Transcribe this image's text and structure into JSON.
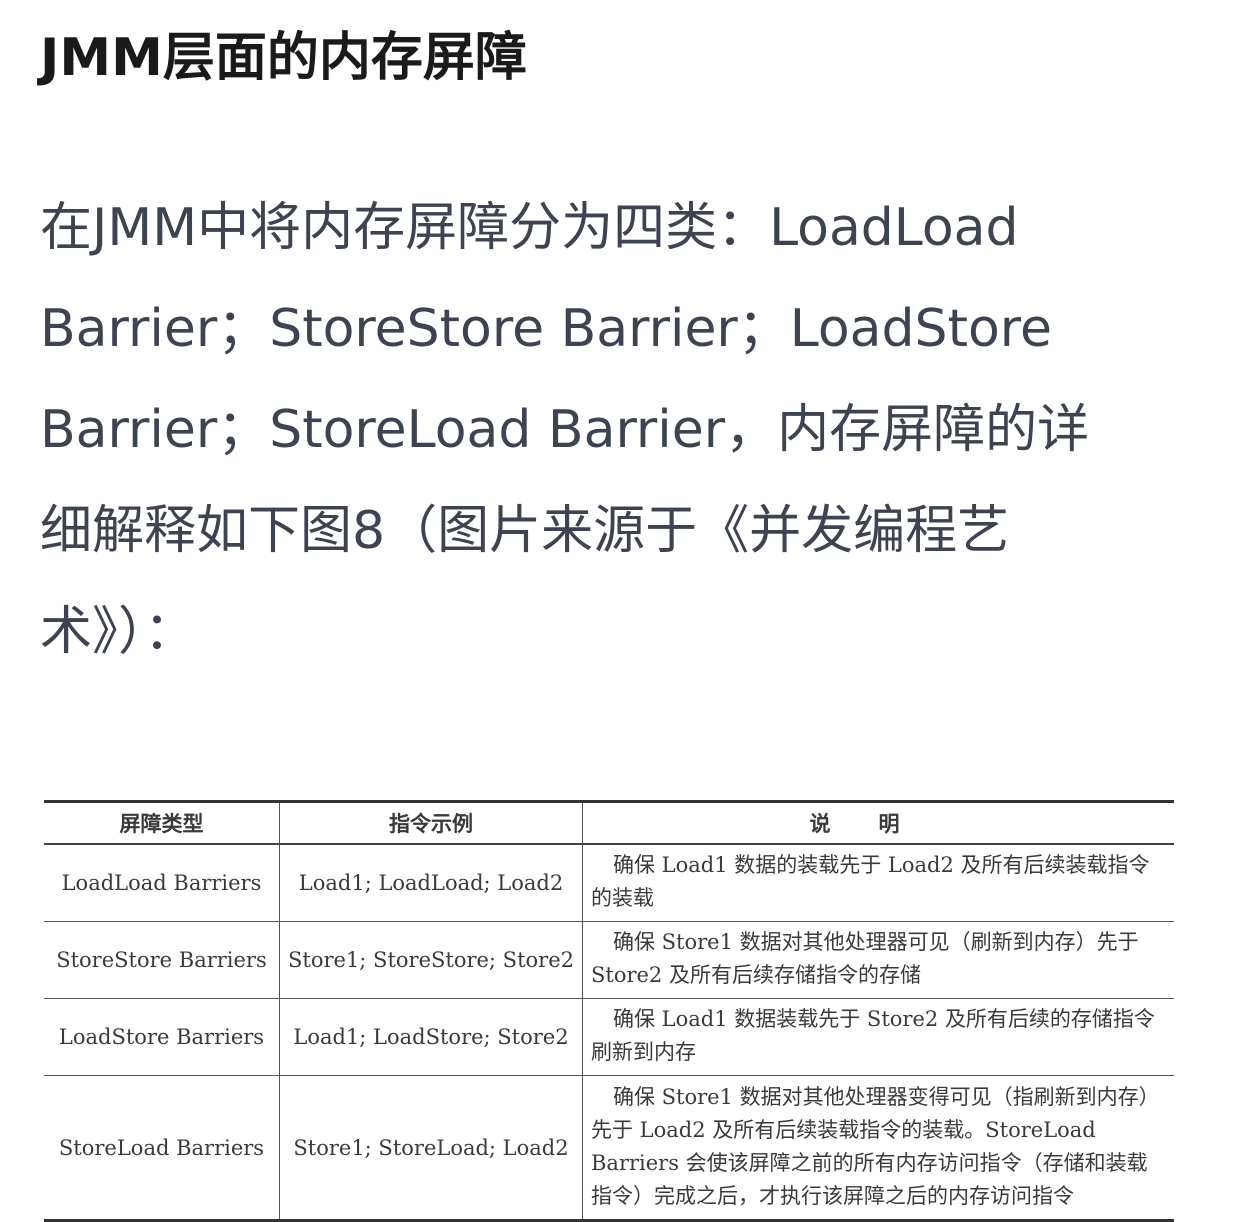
{
  "heading": "JMM层面的内存屏障",
  "paragraph_lines": [
    "在JMM中将内存屏障分为四类：LoadLoad",
    "Barrier；StoreStore Barrier；LoadStore",
    "Barrier；StoreLoad Barrier，内存屏障的详",
    "细解释如下图8（图片来源于《并发编程艺",
    "术》）："
  ],
  "table": {
    "headers": {
      "type": "屏障类型",
      "instruction": "指令示例",
      "description": "说明"
    },
    "rows": [
      {
        "type": "LoadLoad Barriers",
        "instruction": "Load1; LoadLoad; Load2",
        "description": "确保 Load1 数据的装载先于 Load2 及所有后续装载指令的装载"
      },
      {
        "type": "StoreStore Barriers",
        "instruction": "Store1; StoreStore; Store2",
        "description": "确保 Store1 数据对其他处理器可见（刷新到内存）先于 Store2 及所有后续存储指令的存储"
      },
      {
        "type": "LoadStore Barriers",
        "instruction": "Load1; LoadStore; Store2",
        "description": "确保 Load1 数据装载先于 Store2 及所有后续的存储指令刷新到内存"
      },
      {
        "type": "StoreLoad Barriers",
        "instruction": "Store1; StoreLoad; Load2",
        "description": "确保 Store1 数据对其他处理器变得可见（指刷新到内存）先于 Load2 及所有后续装载指令的装载。StoreLoad Barriers 会使该屏障之前的所有内存访问指令（存储和装载指令）完成之后，才执行该屏障之后的内存访问指令"
      }
    ]
  }
}
